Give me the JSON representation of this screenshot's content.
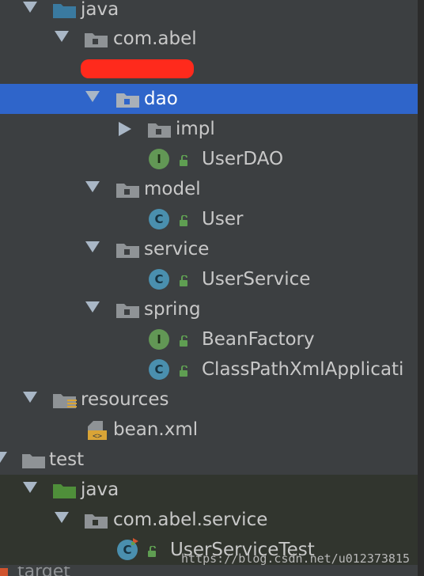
{
  "project_tree": {
    "selected_item": "dao",
    "items": [
      {
        "label": "java",
        "kind": "source-folder",
        "expanded": true
      },
      {
        "label": "com.abel",
        "kind": "package",
        "expanded": true
      },
      {
        "label": "",
        "kind": "redacted"
      },
      {
        "label": "dao",
        "kind": "package",
        "expanded": true,
        "selected": true
      },
      {
        "label": "impl",
        "kind": "package",
        "expanded": false
      },
      {
        "label": "UserDAO",
        "kind": "interface"
      },
      {
        "label": "model",
        "kind": "package",
        "expanded": true
      },
      {
        "label": "User",
        "kind": "class"
      },
      {
        "label": "service",
        "kind": "package",
        "expanded": true
      },
      {
        "label": "UserService",
        "kind": "class"
      },
      {
        "label": "spring",
        "kind": "package",
        "expanded": true
      },
      {
        "label": "BeanFactory",
        "kind": "interface"
      },
      {
        "label": "ClassPathXmlApplicati",
        "kind": "class"
      },
      {
        "label": "resources",
        "kind": "resources-folder",
        "expanded": true
      },
      {
        "label": "bean.xml",
        "kind": "xml-file"
      },
      {
        "label": "test",
        "kind": "folder",
        "expanded": true
      },
      {
        "label": "java",
        "kind": "test-source-folder",
        "expanded": true
      },
      {
        "label": "com.abel.service",
        "kind": "package",
        "expanded": true
      },
      {
        "label": "UserServiceTest",
        "kind": "test-class"
      },
      {
        "label": "target",
        "kind": "folder",
        "partially_visible": true
      }
    ]
  },
  "badges": {
    "interface": "I",
    "class": "C"
  },
  "watermark": "https://blog.csdn.net/u012373815",
  "colors": {
    "background": "#3c3f41",
    "selection": "#2f65ca",
    "test_background": "#31352e",
    "interface_badge": "#629755",
    "class_badge": "#4a8fae",
    "source_folder": "#3a7aa0",
    "test_source_folder": "#4f8f3a",
    "redaction": "#ff2a1c"
  }
}
